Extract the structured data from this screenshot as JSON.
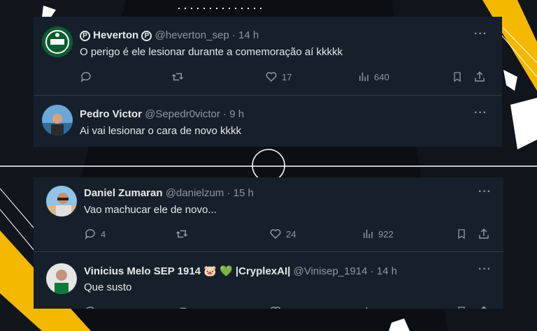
{
  "tweets": [
    {
      "name": "Heverton",
      "name_badge_left": "P",
      "name_badge_right": "P",
      "handle": "@heverton_sep",
      "dot": "·",
      "time": "14 h",
      "text": "O perigo é ele lesionar durante a comemoração aí kkkkk",
      "likes": "17",
      "views": "640",
      "more": "···"
    },
    {
      "name": "Pedro Victor",
      "handle": "@Sepedr0victor",
      "dot": "·",
      "time": "9 h",
      "text": "Ai vai lesionar o cara de novo kkkk",
      "more": "···"
    },
    {
      "name": "Daniel Zumaran",
      "handle": "@danielzum",
      "dot": "·",
      "time": "15 h",
      "text": "Vao machucar ele de novo...",
      "replies": "4",
      "likes": "24",
      "views": "922",
      "more": "···"
    },
    {
      "name": "Vinicius Melo SEP 1914",
      "name_emoji_pig": "🐷",
      "name_emoji_heart": "💚",
      "name_suffix": "|CryplexAI|",
      "handle": "@Vinisep_1914",
      "dot": "·",
      "time": "14 h",
      "text": "Que susto",
      "more": "···"
    }
  ],
  "colors": {
    "card_bg": "#15202b",
    "text": "#e7e9ea",
    "muted": "#8b98a5",
    "accent_yellow": "#f5b800"
  },
  "icons": [
    "reply-icon",
    "retweet-icon",
    "like-icon",
    "views-icon",
    "bookmark-icon",
    "share-icon",
    "more-icon"
  ]
}
